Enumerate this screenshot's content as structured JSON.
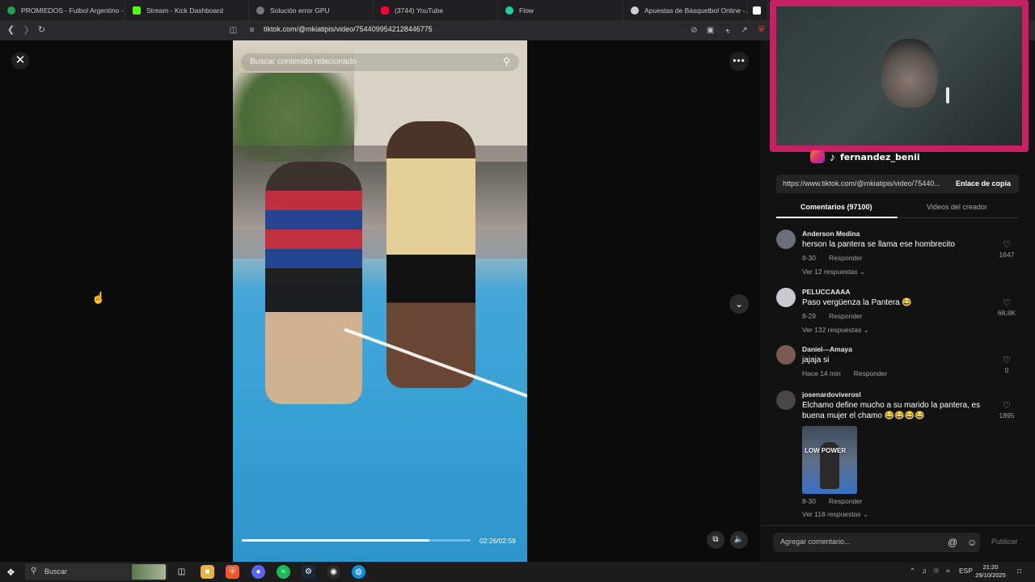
{
  "browser": {
    "tabs": [
      {
        "label": "PROMIEDOS - Futbol Argentino - Fi",
        "color": "#1fa34a"
      },
      {
        "label": "Stream - Kick Dashboard",
        "color": "#53fc18"
      },
      {
        "label": "Solución error GPU",
        "color": "#9a9a9a"
      },
      {
        "label": "(3744) YouTube",
        "color": "#ff0033"
      },
      {
        "label": "Flow",
        "color": "#1fd1a0"
      },
      {
        "label": "Apuestas de Básquetbol Online - Ap",
        "color": "#cfcfcf"
      }
    ],
    "url": "tiktok.com/@mkiatipis/video/7544099542128446775"
  },
  "video": {
    "search_placeholder": "Buscar contenido relacionado",
    "time": "02:26/02:59",
    "progress": 0.82
  },
  "panel": {
    "share_link": "https://www.tiktok.com/@mkiatipis/video/75440...",
    "copy_label": "Enlace de copia",
    "tab_comments": "Comentarios (97100)",
    "tab_creator": "Videos del creador",
    "reply_label": "Responder",
    "comments": [
      {
        "user": "Anderson Medina",
        "text": "herson la pantera se llama ese hombrecito",
        "date": "8-30",
        "likes": "1647",
        "replies": "Ver 12 respuestas",
        "avatar": "#6b6f7a"
      },
      {
        "user": "PELUCCAAAA",
        "text": "Paso vergüenza la Pantera 😂",
        "date": "8-29",
        "likes": "68,8K",
        "replies": "Ver 132 respuestas",
        "avatar": "#c9c9d0"
      },
      {
        "user": "Daniel---Amaya",
        "text": "jajaja si",
        "date": "Hace 14 min",
        "likes": "0",
        "replies": "",
        "avatar": "#7a5a55"
      },
      {
        "user": "josenardoviverosl",
        "text": "Elchamo define mucho a su marido la pantera, es buena mujer el chamo 😂😂😂😂",
        "date": "8-30",
        "likes": "1895",
        "replies": "Ver 118 respuestas",
        "avatar": "#4a4644",
        "gif_label": "LOW POWER"
      }
    ],
    "add_comment_placeholder": "Agregar comentario...",
    "post_label": "Publicar"
  },
  "webcam": {
    "handle": "fernandez_benii"
  },
  "taskbar": {
    "search_label": "Buscar",
    "lang": "ESP",
    "time": "21:20",
    "date": "29/10/2025"
  }
}
